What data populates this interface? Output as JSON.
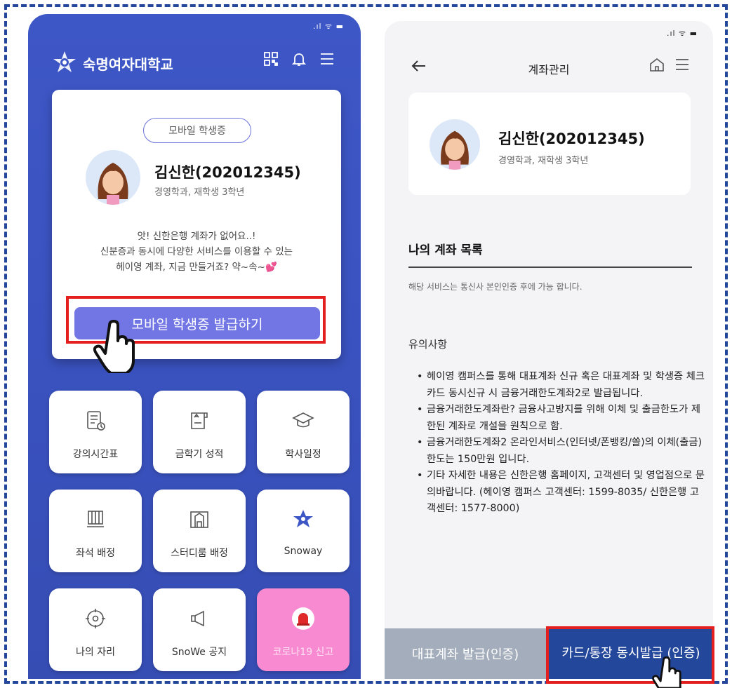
{
  "colors": {
    "brand_blue": "#3e57c6",
    "dark_blue": "#23479a",
    "accent_purple": "#7176e4",
    "highlight_red": "#e41f1f",
    "covid_pink": "#f88ad1"
  },
  "left_screen": {
    "header": {
      "title": "숙명여자대학교",
      "icons": [
        "qr-code-icon",
        "bell-icon",
        "menu-icon"
      ]
    },
    "card": {
      "badge": "모바일 학생증",
      "name": "김신한(202012345)",
      "dept": "경영학과, 재학생 3학년",
      "notice": [
        "앗! 신한은행 계좌가 없어요..!",
        "신분증과 동시에 다양한 서비스를 이용할 수 있는",
        "헤이영 계좌, 지금 만들거죠? 약~속~💕"
      ],
      "issue_button": "모바일 학생증 발급하기"
    },
    "tiles": [
      {
        "label": "강의시간표",
        "icon": "timetable-icon"
      },
      {
        "label": "금학기 성적",
        "icon": "grade-icon"
      },
      {
        "label": "학사일정",
        "icon": "graduation-cap-icon"
      },
      {
        "label": "좌석 배정",
        "icon": "seat-icon"
      },
      {
        "label": "스터디룸 배정",
        "icon": "study-room-icon"
      },
      {
        "label": "Snoway",
        "icon": "snoway-icon"
      },
      {
        "label": "나의 자리",
        "icon": "location-icon"
      },
      {
        "label": "SnoWe 공지",
        "icon": "megaphone-icon"
      },
      {
        "label": "코로나19 신고",
        "icon": "siren-icon"
      }
    ]
  },
  "right_screen": {
    "header": {
      "title": "계좌관리",
      "icons": [
        "back-arrow-icon",
        "home-icon",
        "menu-icon"
      ]
    },
    "profile": {
      "name": "김신한(202012345)",
      "dept": "경영학과, 재학생 3학년"
    },
    "section_title": "나의 계좌 목록",
    "section_note": "해당 서비스는 통신사 본인인증 후에 가능 합니다.",
    "caution_title": "유의사항",
    "caution_items": [
      "헤이영 캠퍼스를 통해 대표계좌 신규 혹은 대표계좌 및 학생증 체크카드 동시신규 시 금융거래한도계좌2로 발급됩니다.",
      "금융거래한도계좌란? 금융사고방지를 위해 이체 및 출금한도가 제한된 계좌로 개설을 원칙으로 함.",
      "금융거래한도계좌2 온라인서비스(인터넷/폰뱅킹/쏠)의 이체(출금)한도는 150만원 입니다.",
      "기타 자세한 내용은 신한은행 홈페이지, 고객센터 및 영업점으로 문의바랍니다. (헤이영 캠퍼스 고객센터: 1599-8035/ 신한은행 고객센터: 1577-8000)"
    ],
    "buttons": {
      "primary_account": "대표계좌 발급(인증)",
      "card_bankbook": "카드/통장 동시발급 (인증)"
    }
  }
}
